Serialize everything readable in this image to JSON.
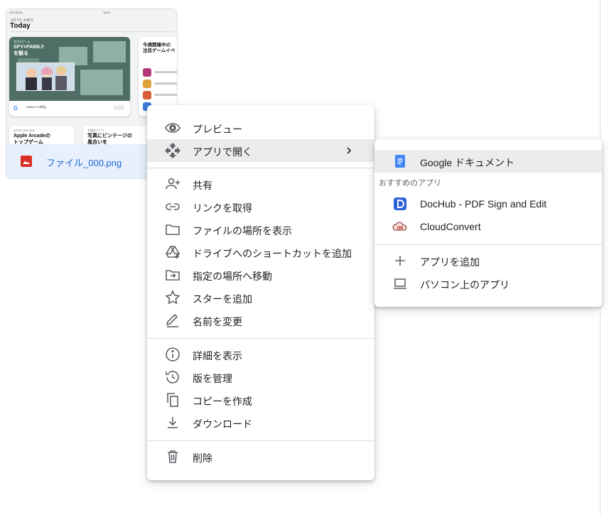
{
  "file": {
    "name": "ファイル_000.png",
    "type_icon": "image-file-icon",
    "thumbnail": {
      "status_time": "9月7日(水)",
      "status_right": "100%",
      "date_line": "9月7日 水曜日",
      "heading": "Today",
      "feature_card": {
        "subtitle": "注目のゲーム",
        "title": "SPY×FAMILY\nを観る",
        "app_name": "Netflix(TV/映画)",
        "button": "入手"
      },
      "side_card": {
        "title": "今週開催中の\n注目ゲームイベ"
      },
      "bottom_cards": [
        {
          "header": "APPLE ARCADE",
          "title": "Apple Arcadeの\nトップゲーム"
        },
        {
          "header": "今週のアプリ",
          "title": "写真にビンテージの\n風合いを"
        }
      ]
    }
  },
  "context_menu": {
    "groups": [
      [
        {
          "label": "プレビュー",
          "icon": "eye-icon"
        },
        {
          "label": "アプリで開く",
          "icon": "open-with-icon",
          "submenu": true,
          "highlighted": true
        }
      ],
      [
        {
          "label": "共有",
          "icon": "person-add-icon"
        },
        {
          "label": "リンクを取得",
          "icon": "link-icon"
        },
        {
          "label": "ファイルの場所を表示",
          "icon": "folder-icon"
        },
        {
          "label": "ドライブへのショートカットを追加",
          "icon": "drive-shortcut-icon"
        },
        {
          "label": "指定の場所へ移動",
          "icon": "move-to-folder-icon"
        },
        {
          "label": "スターを追加",
          "icon": "star-icon"
        },
        {
          "label": "名前を変更",
          "icon": "rename-pen-icon"
        }
      ],
      [
        {
          "label": "詳細を表示",
          "icon": "info-icon"
        },
        {
          "label": "版を管理",
          "icon": "history-icon"
        },
        {
          "label": "コピーを作成",
          "icon": "copy-icon"
        },
        {
          "label": "ダウンロード",
          "icon": "download-icon"
        }
      ],
      [
        {
          "label": "削除",
          "icon": "trash-icon"
        }
      ]
    ]
  },
  "open_with_menu": {
    "primary": {
      "label": "Google ドキュメント",
      "icon": "google-docs-icon"
    },
    "section_title": "おすすめのアプリ",
    "suggested": [
      {
        "label": "DocHub - PDF Sign and Edit",
        "icon": "dochub-icon"
      },
      {
        "label": "CloudConvert",
        "icon": "cloudconvert-icon"
      }
    ],
    "actions": [
      {
        "label": "アプリを追加",
        "icon": "plus-icon"
      },
      {
        "label": "パソコン上のアプリ",
        "icon": "laptop-icon"
      }
    ]
  },
  "colors": {
    "icon_gray": "#5f6368",
    "highlight": "#ececec",
    "file_selected_bg": "#e8f0fe",
    "file_name": "#1967d2",
    "image_icon_red": "#d93025",
    "docs_blue": "#4285f4",
    "dochub_blue": "#2b62d9"
  }
}
